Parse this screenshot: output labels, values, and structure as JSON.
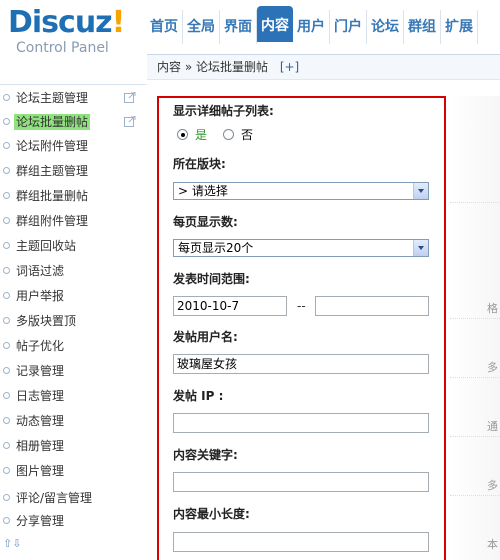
{
  "app": {
    "brand": "Discuz",
    "brand_bang": "!",
    "brand_sub": "Control Panel"
  },
  "nav": {
    "items": [
      {
        "label": "首页"
      },
      {
        "label": "全局"
      },
      {
        "label": "界面"
      },
      {
        "label": "内容",
        "active": true
      },
      {
        "label": "用户"
      },
      {
        "label": "门户"
      },
      {
        "label": "论坛"
      },
      {
        "label": "群组"
      },
      {
        "label": "扩展"
      }
    ]
  },
  "breadcrumb": {
    "text": "内容 » 论坛批量删帖",
    "add_label": "[+]"
  },
  "sidebar": {
    "items": [
      {
        "label": "论坛主题管理",
        "ext": true
      },
      {
        "label": "论坛批量删帖",
        "active": true,
        "ext": true
      },
      {
        "label": "论坛附件管理"
      },
      {
        "label": "群组主题管理"
      },
      {
        "label": "群组批量删帖"
      },
      {
        "label": "群组附件管理"
      },
      {
        "label": "主题回收站"
      },
      {
        "label": "词语过滤"
      },
      {
        "label": "用户举报"
      },
      {
        "label": "多版块置顶"
      },
      {
        "label": "帖子优化"
      },
      {
        "label": "记录管理"
      },
      {
        "label": "日志管理"
      },
      {
        "label": "动态管理"
      },
      {
        "label": "相册管理"
      },
      {
        "label": "图片管理"
      },
      {
        "label": "评论/留言管理"
      },
      {
        "label": "分享管理"
      }
    ],
    "arrows": "⇧⇩"
  },
  "form": {
    "detail_list_label": "显示详细帖子列表:",
    "radio_yes": "是",
    "radio_no": "否",
    "forum_label": "所在版块:",
    "forum_select": " > 请选择",
    "perpage_label": "每页显示数:",
    "perpage_select": "每页显示20个",
    "time_range_label": "发表时间范围:",
    "time_from": "2010-10-7",
    "time_sep": "--",
    "time_to": "",
    "author_label": "发帖用户名:",
    "author_value": "玻璃屋女孩",
    "ip_label": "发帖  IP :",
    "ip_value": "",
    "keyword_label": "内容关键字:",
    "keyword_value": "",
    "minlen_label": "内容最小长度:",
    "minlen_value": ""
  },
  "tips": {
    "t1": "格",
    "t2": "多",
    "t3": "通",
    "t4": "多",
    "t5": "本"
  }
}
